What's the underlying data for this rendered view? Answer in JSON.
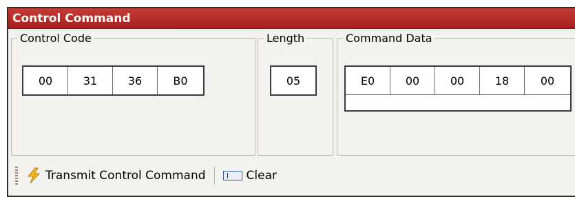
{
  "panel": {
    "title": "Control Command"
  },
  "control_code": {
    "legend": "Control Code",
    "bytes": [
      "00",
      "31",
      "36",
      "B0"
    ]
  },
  "length": {
    "legend": "Length",
    "value": "05"
  },
  "command_data": {
    "legend": "Command Data",
    "bytes": [
      "E0",
      "00",
      "00",
      "18",
      "00"
    ]
  },
  "toolbar": {
    "transmit_label": "Transmit Control Command",
    "clear_label": "Clear",
    "transmit_icon": "lightning-bolt-icon",
    "clear_icon": "clear-textbox-icon"
  },
  "colors": {
    "title_bar": "#b12724",
    "panel_bg": "#f3f2ee",
    "bolt": "#f2b01e"
  }
}
